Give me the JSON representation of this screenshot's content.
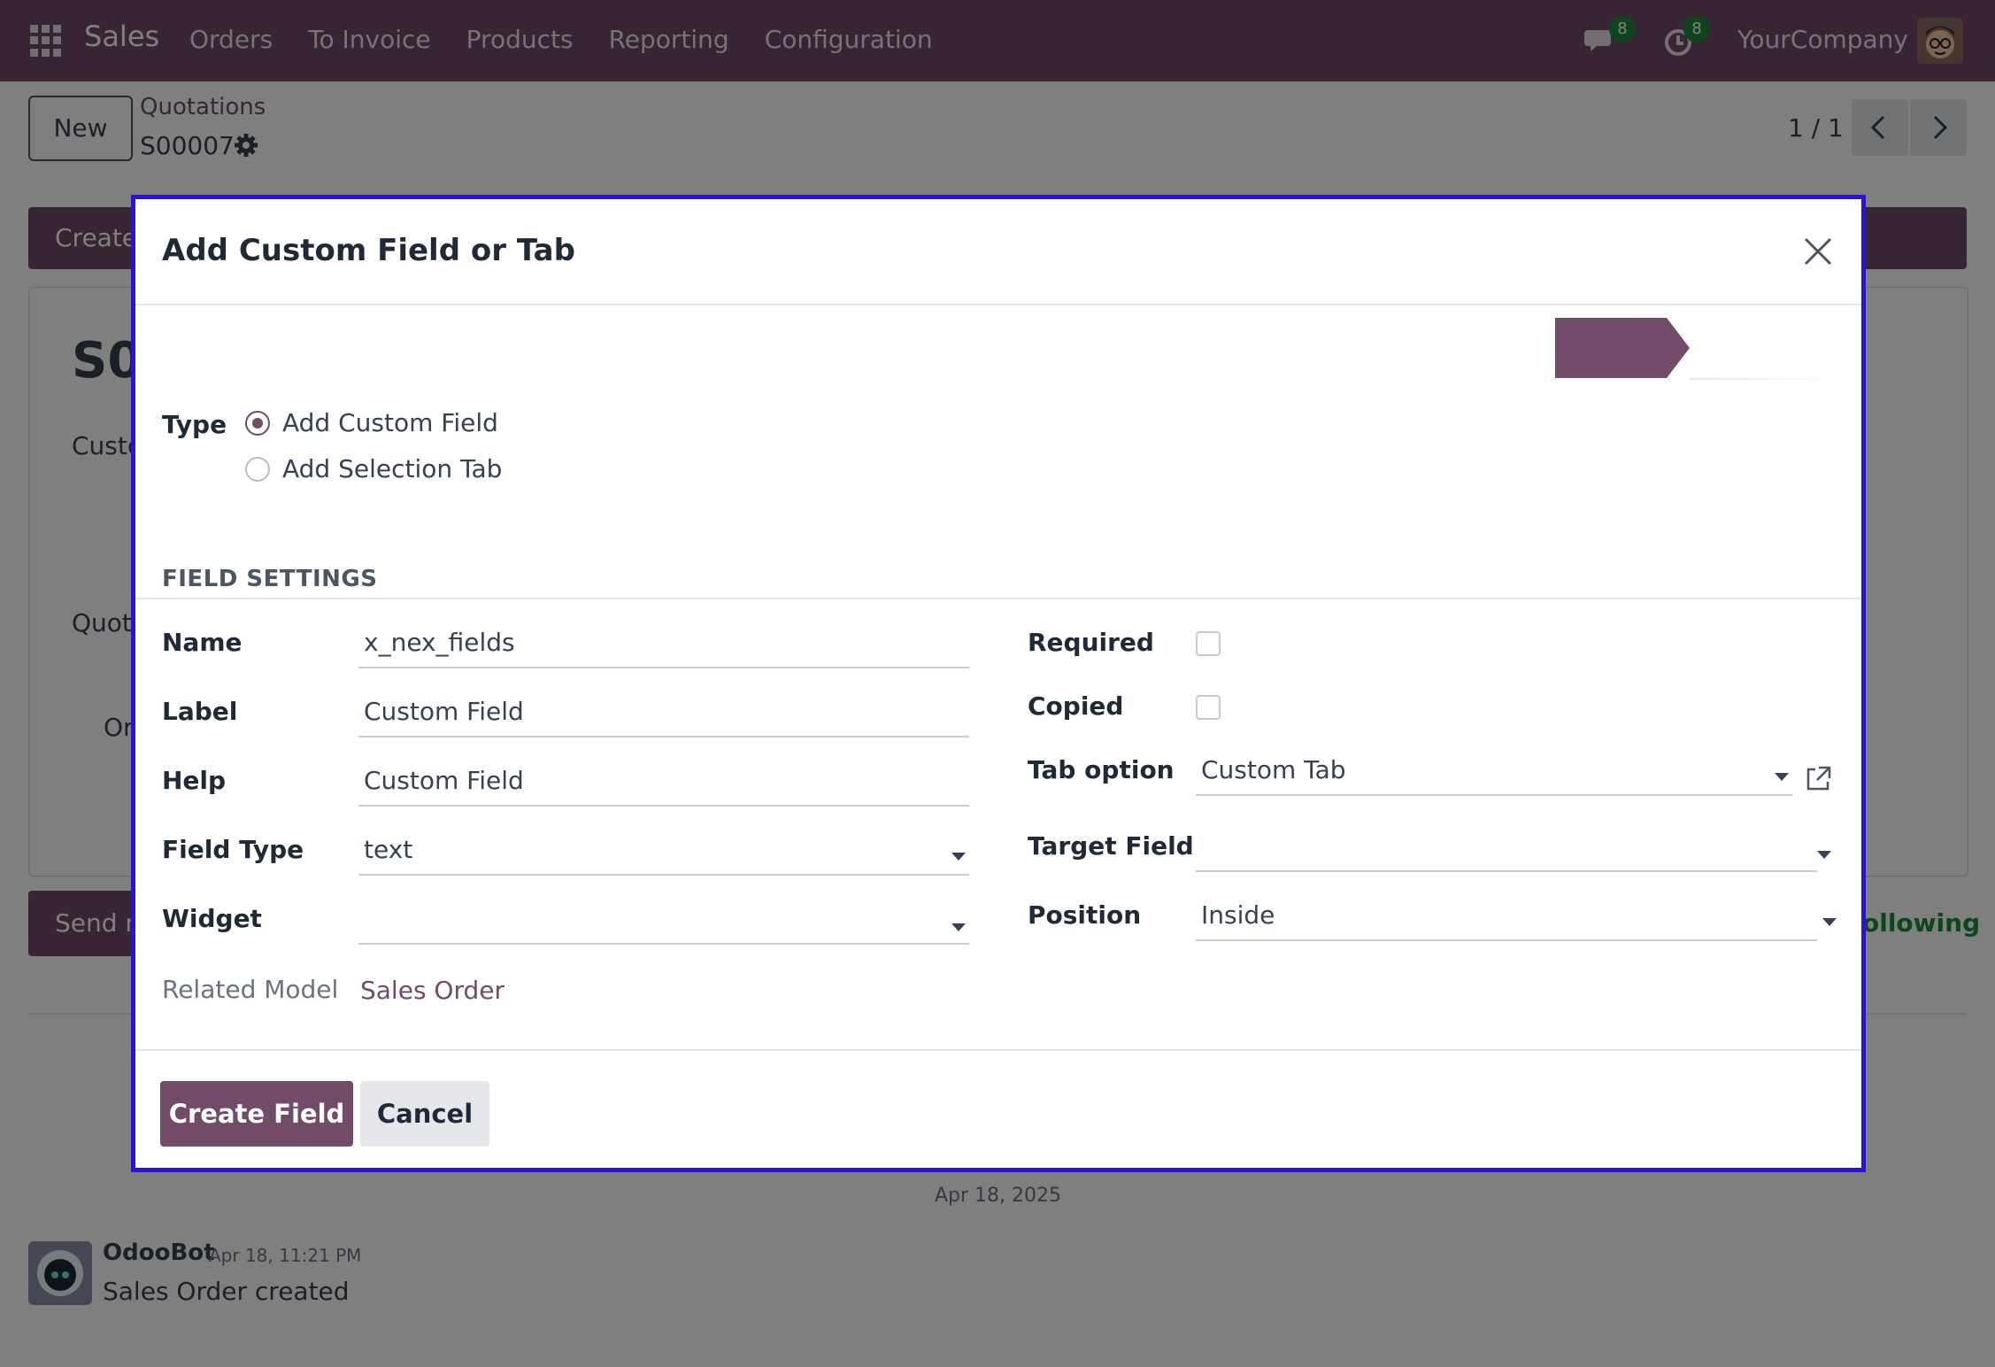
{
  "navbar": {
    "app_name": "Sales",
    "menu": [
      "Orders",
      "To Invoice",
      "Products",
      "Reporting",
      "Configuration"
    ],
    "messages_badge": "8",
    "activities_badge": "8",
    "company": "YourCompany"
  },
  "control_panel": {
    "new_label": "New",
    "breadcrumb_parent": "Quotations",
    "breadcrumb_current": "S00007",
    "pager": "1 / 1"
  },
  "background": {
    "create_btn": "Create",
    "record_name_partial": "S0",
    "customer_partial": "Custo",
    "quotation_partial": "Quot",
    "order_partial": "Or",
    "send_btn_partial": "Send m",
    "following_partial": "ollowing",
    "date_separator": "Apr 18, 2025",
    "message_author": "OdooBot",
    "message_time": "Apr 18, 11:21 PM",
    "message_body": "Sales Order created"
  },
  "dialog": {
    "title": "Add Custom Field or Tab",
    "type_label": "Type",
    "type_options": [
      "Add Custom Field",
      "Add Selection Tab"
    ],
    "type_selected": "Add Custom Field",
    "section_title": "FIELD SETTINGS",
    "fields_left": {
      "name_label": "Name",
      "name_value": "x_nex_fields",
      "label_label": "Label",
      "label_value": "Custom Field",
      "help_label": "Help",
      "help_value": "Custom Field",
      "field_type_label": "Field Type",
      "field_type_value": "text",
      "widget_label": "Widget",
      "widget_value": "",
      "related_model_label": "Related Model",
      "related_model_value": "Sales Order"
    },
    "fields_right": {
      "required_label": "Required",
      "required_checked": false,
      "copied_label": "Copied",
      "copied_checked": false,
      "tab_option_label": "Tab option",
      "tab_option_value": "Custom Tab",
      "target_field_label": "Target Field",
      "target_field_value": "",
      "position_label": "Position",
      "position_value": "Inside"
    },
    "create_btn": "Create Field",
    "cancel_btn": "Cancel"
  },
  "colors": {
    "brand": "#714b67",
    "dialog_border": "#2b13d6",
    "badge": "#1f8a38"
  }
}
